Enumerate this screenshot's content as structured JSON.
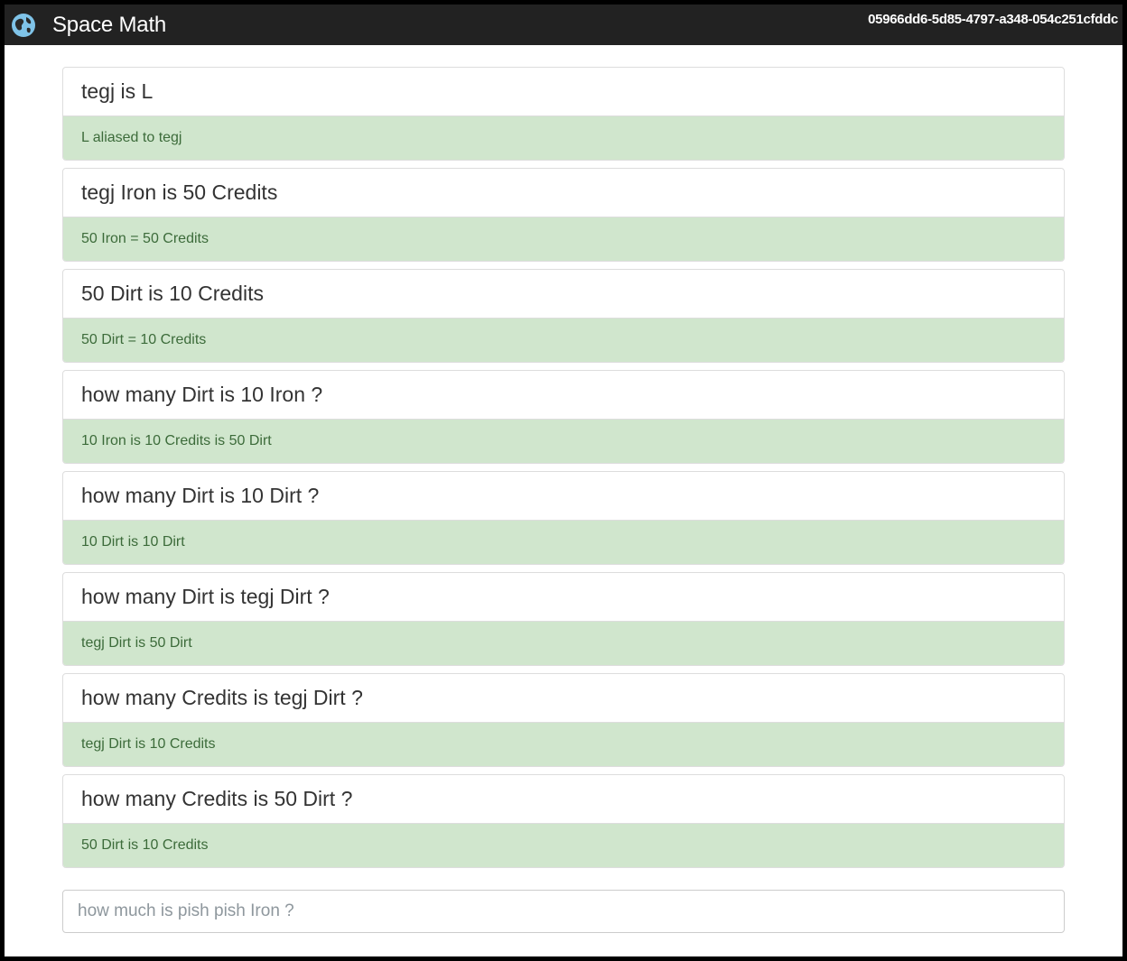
{
  "navbar": {
    "brand": "Space Math",
    "session_id": "05966dd6-5d85-4797-a348-054c251cfddc",
    "logo_icon": "globe-icon"
  },
  "results": [
    {
      "question": "tegj is L",
      "answer": "L aliased to tegj"
    },
    {
      "question": "tegj Iron is 50 Credits",
      "answer": "50 Iron = 50 Credits"
    },
    {
      "question": "50 Dirt is 10 Credits",
      "answer": "50 Dirt = 10 Credits"
    },
    {
      "question": "how many Dirt is 10 Iron ?",
      "answer": "10 Iron is 10 Credits is 50 Dirt"
    },
    {
      "question": "how many Dirt is 10 Dirt ?",
      "answer": "10 Dirt is 10 Dirt"
    },
    {
      "question": "how many Dirt is tegj Dirt ?",
      "answer": "tegj Dirt is 50 Dirt"
    },
    {
      "question": "how many Credits is tegj Dirt ?",
      "answer": "tegj Dirt is 10 Credits"
    },
    {
      "question": "how many Credits is 50 Dirt ?",
      "answer": "50 Dirt is 10 Credits"
    }
  ],
  "query": {
    "value": "",
    "placeholder": "how much is pish pish Iron ?"
  },
  "colors": {
    "navbar_bg": "#222222",
    "answer_bg": "#d0e6cd",
    "answer_text": "#3c6b3a"
  }
}
